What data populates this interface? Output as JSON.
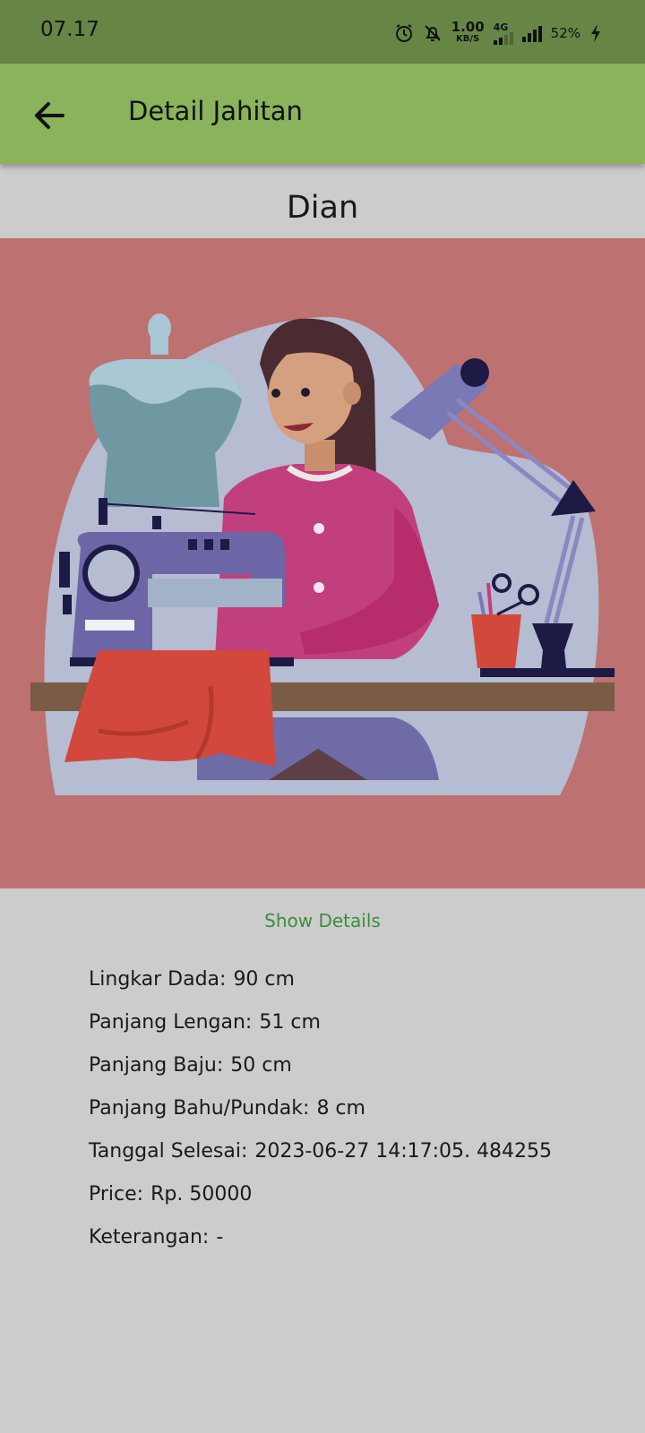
{
  "status": {
    "time": "07.17",
    "speed_value": "1.00",
    "speed_unit": "KB/S",
    "network": "4G",
    "battery": "52%"
  },
  "appbar": {
    "title": "Detail Jahitan"
  },
  "customer": {
    "name": "Dian"
  },
  "show_details_label": "Show Details",
  "details": [
    {
      "label": "Lingkar Dada:",
      "value": "90 cm"
    },
    {
      "label": "Panjang Lengan:",
      "value": "51 cm"
    },
    {
      "label": "Panjang Baju:",
      "value": "50 cm"
    },
    {
      "label": "Panjang Bahu/Pundak:",
      "value": "8 cm"
    },
    {
      "label": "Tanggal Selesai:",
      "value": "2023-06-27 14:17:05. 484255"
    },
    {
      "label": "Price:",
      "value": "Rp.  50000"
    },
    {
      "label": "Keterangan:",
      "value": "-"
    }
  ],
  "icons": {
    "back": "arrow-left-icon",
    "alarm": "alarm-icon",
    "mute": "bell-off-icon",
    "signal": "signal-bars-icon",
    "charging": "lightning-icon"
  },
  "colors": {
    "status_bar": "#678545",
    "app_bar": "#8ab35b",
    "background": "#cccccc",
    "illustration_bg": "#bd7170",
    "link": "#3a8f3a"
  }
}
